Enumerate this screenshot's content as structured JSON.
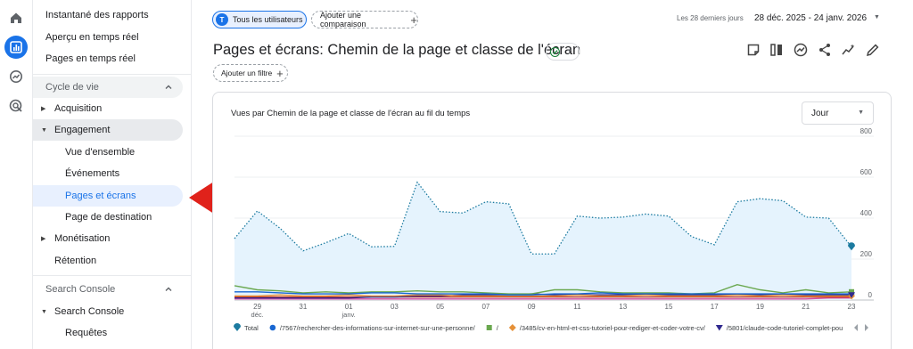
{
  "sidebar": {
    "items": [
      {
        "label": "Instantané des rapports",
        "level": 1,
        "top": 5
      },
      {
        "label": "Aperçu en temps réel",
        "level": 1,
        "top": 30
      },
      {
        "label": "Pages en temps réel",
        "level": 1,
        "top": 54
      }
    ],
    "lifecycle": {
      "section_label": "Cycle de vie",
      "items": [
        {
          "label": "Acquisition"
        },
        {
          "label": "Engagement"
        },
        {
          "label": "Vue d'ensemble"
        },
        {
          "label": "Événements"
        },
        {
          "label": "Pages et écrans"
        },
        {
          "label": "Page de destination"
        },
        {
          "label": "Monétisation"
        },
        {
          "label": "Rétention"
        }
      ]
    },
    "search_console": {
      "section_label": "Search Console",
      "items": [
        {
          "label": "Search Console"
        },
        {
          "label": "Requêtes"
        }
      ]
    }
  },
  "topbar": {
    "users_chip": {
      "avatar": "T",
      "label": "Tous les utilisateurs"
    },
    "compare_chip": {
      "label": "Ajouter une comparaison"
    },
    "date_label": "Les 28 derniers jours",
    "date_range": "28 déc. 2025 - 24 janv. 2026"
  },
  "page": {
    "title": "Pages et écrans: Chemin de la page et classe de l'écran",
    "filter_chip": "Ajouter un filtre"
  },
  "toolbar_icons": [
    "note-icon",
    "compare-columns-icon",
    "insights-icon",
    "share-icon",
    "trend-icon",
    "edit-icon"
  ],
  "colors": {
    "accent": "#1a73e8",
    "selected_bg": "#e8f0fe",
    "total_line": "#1c7ba0",
    "area_fill": "#e5f3fd",
    "arrow": "#e0221b"
  },
  "chart": {
    "title": "Vues par Chemin de la page et classe de l'écran au fil du temps",
    "granularity": "Jour"
  },
  "chart_data": {
    "type": "line",
    "title": "Vues par Chemin de la page et classe de l'écran au fil du temps",
    "ylim": [
      0,
      800
    ],
    "yticks": [
      "800",
      "600",
      "400",
      "200",
      "0"
    ],
    "x_ticks": [
      {
        "day": "29",
        "month": "déc."
      },
      {
        "day": "31",
        "month": ""
      },
      {
        "day": "01",
        "month": "janv."
      },
      {
        "day": "03",
        "month": ""
      },
      {
        "day": "05",
        "month": ""
      },
      {
        "day": "07",
        "month": ""
      },
      {
        "day": "09",
        "month": ""
      },
      {
        "day": "11",
        "month": ""
      },
      {
        "day": "13",
        "month": ""
      },
      {
        "day": "15",
        "month": ""
      },
      {
        "day": "17",
        "month": ""
      },
      {
        "day": "19",
        "month": ""
      },
      {
        "day": "21",
        "month": ""
      },
      {
        "day": "23",
        "month": ""
      }
    ],
    "x": [
      "28 déc.",
      "29 déc.",
      "30 déc.",
      "31 déc.",
      "01 janv.",
      "02 janv.",
      "03 janv.",
      "04 janv.",
      "05 janv.",
      "06 janv.",
      "07 janv.",
      "08 janv.",
      "09 janv.",
      "10 janv.",
      "11 janv.",
      "12 janv.",
      "13 janv.",
      "14 janv.",
      "15 janv.",
      "16 janv.",
      "17 janv.",
      "18 janv.",
      "19 janv.",
      "20 janv.",
      "21 janv.",
      "22 janv.",
      "23 janv.",
      "24 janv."
    ],
    "series": [
      {
        "name": "Total",
        "color": "#1c7ba0",
        "style": "dotted",
        "marker": "pin",
        "values": [
          300,
          435,
          350,
          240,
          280,
          325,
          260,
          262,
          575,
          432,
          425,
          480,
          470,
          225,
          225,
          410,
          400,
          405,
          420,
          410,
          310,
          270,
          480,
          495,
          485,
          405,
          400,
          260
        ]
      },
      {
        "name": "/7567/rechercher-des-informations-sur-internet-sur-une-personne/",
        "color": "#1967d2",
        "style": "solid",
        "marker": "circle",
        "values": [
          40,
          40,
          35,
          30,
          30,
          30,
          35,
          35,
          30,
          30,
          30,
          30,
          25,
          25,
          30,
          30,
          35,
          30,
          30,
          30,
          30,
          30,
          30,
          30,
          30,
          30,
          30,
          30
        ]
      },
      {
        "name": "/",
        "color": "#6aa84f",
        "style": "solid",
        "marker": "square",
        "values": [
          70,
          50,
          45,
          35,
          40,
          35,
          40,
          40,
          45,
          40,
          40,
          35,
          30,
          30,
          50,
          50,
          40,
          35,
          35,
          35,
          30,
          35,
          75,
          50,
          35,
          50,
          35,
          40
        ]
      },
      {
        "name": "/3485/cv-en-html-et-css-tutoriel-pour-rediger-et-coder-votre-cv/",
        "color": "#e69138",
        "style": "solid",
        "marker": "diamond",
        "values": [
          20,
          20,
          25,
          20,
          20,
          25,
          20,
          20,
          25,
          25,
          20,
          20,
          20,
          20,
          20,
          25,
          20,
          20,
          25,
          20,
          20,
          20,
          25,
          20,
          25,
          20,
          20,
          20
        ]
      },
      {
        "name": "/5801/claude-code-tutoriel-complet-pou",
        "color": "#312a8f",
        "style": "solid",
        "marker": "triangle",
        "values": [
          10,
          10,
          10,
          10,
          10,
          10,
          15,
          15,
          20,
          20,
          25,
          25,
          25,
          30,
          25,
          25,
          25,
          25,
          25,
          25,
          25,
          25,
          25,
          25,
          25,
          25,
          25,
          25
        ]
      },
      {
        "name": "",
        "color": "#c53929",
        "style": "solid",
        "marker": "none",
        "values": [
          15,
          15,
          15,
          15,
          15,
          15,
          15,
          15,
          15,
          15,
          15,
          15,
          15,
          15,
          15,
          15,
          15,
          15,
          15,
          15,
          15,
          15,
          15,
          15,
          15,
          15,
          15,
          15
        ]
      },
      {
        "name": "",
        "color": "#d5489b",
        "style": "solid",
        "marker": "none",
        "values": [
          5,
          5,
          5,
          5,
          5,
          5,
          5,
          5,
          5,
          5,
          5,
          5,
          5,
          5,
          5,
          5,
          5,
          5,
          5,
          5,
          5,
          5,
          5,
          5,
          5,
          5,
          10,
          10
        ]
      }
    ],
    "grid": true,
    "legend": "bottom"
  }
}
